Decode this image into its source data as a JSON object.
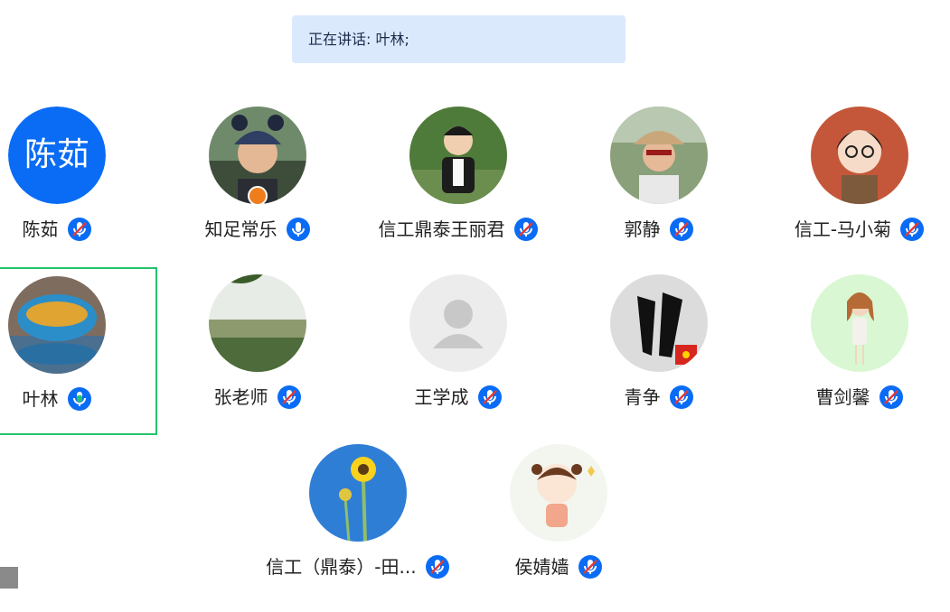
{
  "banner": {
    "text": "正在讲话: 叶林;"
  },
  "participants": [
    {
      "name": "陈茹",
      "avatar_text": "陈茹",
      "mic": "muted"
    },
    {
      "name": "知足常乐",
      "mic": "on",
      "host": true
    },
    {
      "name": "信工鼎泰王丽君",
      "mic": "muted"
    },
    {
      "name": "郭静",
      "mic": "muted"
    },
    {
      "name": "信工-马小菊",
      "mic": "muted"
    },
    {
      "name": "叶林",
      "mic": "speaking",
      "active": true
    },
    {
      "name": "张老师",
      "mic": "muted"
    },
    {
      "name": "王学成",
      "mic": "muted"
    },
    {
      "name": "青争",
      "mic": "muted"
    },
    {
      "name": "曹剑馨",
      "mic": "muted"
    },
    {
      "name": "信工（鼎泰）-田...",
      "mic": "muted"
    },
    {
      "name": "侯婧嫱",
      "mic": "muted"
    }
  ],
  "colors": {
    "accent": "#0a6cf5",
    "speaking": "#22c36b",
    "banner_bg": "#dbe9fd"
  }
}
